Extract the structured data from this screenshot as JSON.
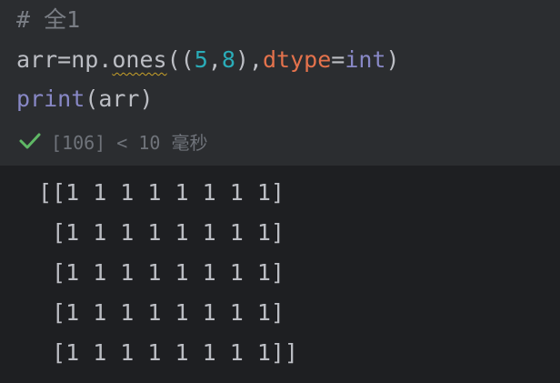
{
  "code": {
    "comment": "# 全1",
    "line2": {
      "prefix": "arr=np.",
      "func": "ones",
      "open": "((",
      "n1": "5",
      "comma": ",",
      "n2": "8",
      "close_comma": "),",
      "param": "dtype",
      "assign": "=",
      "builtin": "int",
      "end": ")"
    },
    "line3": {
      "func": "print",
      "args": "(arr)"
    }
  },
  "status": {
    "icon": "check-icon",
    "icon_color": "#5fb865",
    "text": "[106] < 10 毫秒"
  },
  "output": {
    "lines": [
      "[[1 1 1 1 1 1 1 1]",
      " [1 1 1 1 1 1 1 1]",
      " [1 1 1 1 1 1 1 1]",
      " [1 1 1 1 1 1 1 1]",
      " [1 1 1 1 1 1 1 1]]"
    ]
  }
}
